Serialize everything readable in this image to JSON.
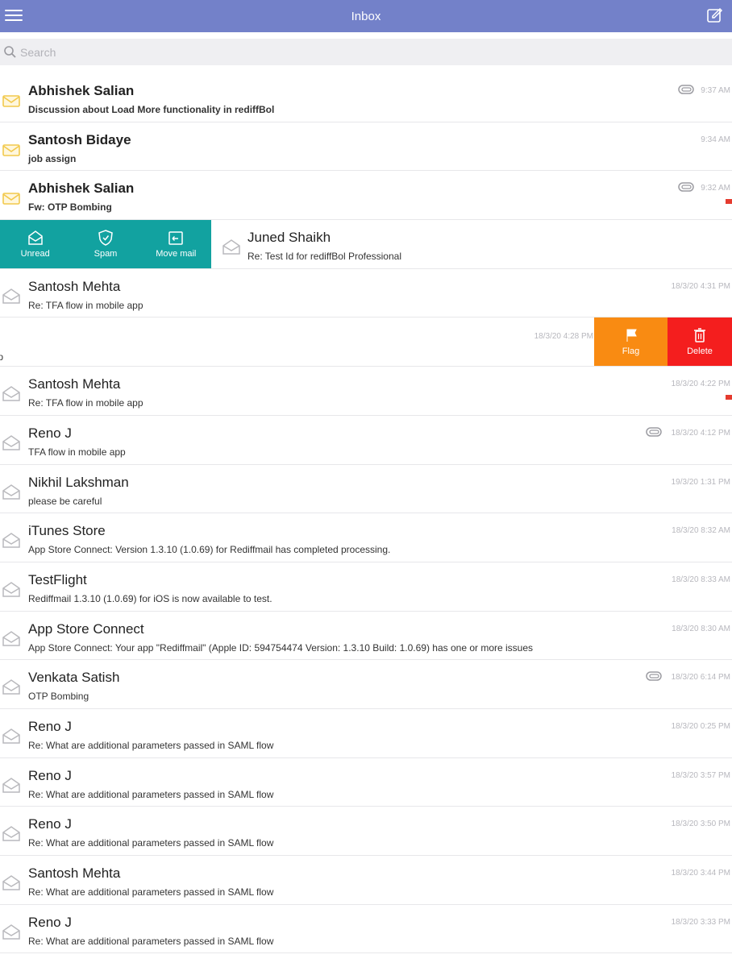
{
  "navbar": {
    "title": "Inbox",
    "menu_icon": "hamburger-menu-icon",
    "compose_icon": "compose-icon"
  },
  "search": {
    "placeholder": "Search",
    "icon": "search-icon"
  },
  "swipe_right_actions": [
    {
      "label": "Unread",
      "icon": "envelope-open-icon"
    },
    {
      "label": "Spam",
      "icon": "shield-icon"
    },
    {
      "label": "Move mail",
      "icon": "folder-move-icon"
    }
  ],
  "swipe_left_actions": [
    {
      "label": "Flag",
      "icon": "flag-icon",
      "color": "#f98b12"
    },
    {
      "label": "Delete",
      "icon": "trash-icon",
      "color": "#f41e1e"
    }
  ],
  "emails": [
    {
      "sender": "Abhishek Salian",
      "subject": "Discussion about Load More functionality in rediffBol",
      "time": "9:37 AM",
      "unread": true,
      "attachment": true,
      "flagged": false
    },
    {
      "sender": "Santosh Bidaye",
      "subject": "job assign",
      "time": "9:34 AM",
      "unread": true,
      "attachment": false,
      "flagged": false
    },
    {
      "sender": "Abhishek Salian",
      "subject": "Fw: OTP Bombing",
      "time": "9:32 AM",
      "unread": true,
      "attachment": true,
      "flagged": true
    },
    {
      "sender": "Juned Shaikh",
      "subject": "Re: Test Id for rediffBol Professional",
      "time": "",
      "unread": false,
      "attachment": false,
      "flagged": false,
      "swipe": "right"
    },
    {
      "sender": "Santosh Mehta",
      "subject": "Re: TFA flow in mobile app",
      "time": "18/3/20 4:31 PM",
      "unread": false,
      "attachment": false,
      "flagged": false
    },
    {
      "sender": "",
      "subject": "app",
      "time": "18/3/20 4:28 PM",
      "unread": false,
      "attachment": false,
      "flagged": false,
      "swipe": "left"
    },
    {
      "sender": "Santosh Mehta",
      "subject": "Re: TFA flow in mobile app",
      "time": "18/3/20 4:22 PM",
      "unread": false,
      "attachment": false,
      "flagged": true
    },
    {
      "sender": "Reno J",
      "subject": "TFA flow in mobile app",
      "time": "18/3/20 4:12 PM",
      "unread": false,
      "attachment": true,
      "flagged": false
    },
    {
      "sender": "Nikhil Lakshman",
      "subject": "please be careful",
      "time": "19/3/20 1:31 PM",
      "unread": false,
      "attachment": false,
      "flagged": false
    },
    {
      "sender": "iTunes Store",
      "subject": "App Store Connect: Version 1.3.10 (1.0.69) for Rediffmail has completed processing.",
      "time": "18/3/20 8:32 AM",
      "unread": false,
      "attachment": false,
      "flagged": false
    },
    {
      "sender": "TestFlight",
      "subject": "Rediffmail 1.3.10 (1.0.69) for iOS is now available to test.",
      "time": "18/3/20 8:33 AM",
      "unread": false,
      "attachment": false,
      "flagged": false
    },
    {
      "sender": "App Store Connect",
      "subject": "App Store Connect: Your app \"Rediffmail\" (Apple ID: 594754474 Version: 1.3.10 Build: 1.0.69) has one or more issues",
      "time": "18/3/20 8:30 AM",
      "unread": false,
      "attachment": false,
      "flagged": false
    },
    {
      "sender": "Venkata Satish",
      "subject": "OTP Bombing",
      "time": "18/3/20 6:14 PM",
      "unread": false,
      "attachment": true,
      "flagged": false
    },
    {
      "sender": "Reno J",
      "subject": "Re: What are additional parameters passed in SAML flow",
      "time": "18/3/20 0:25 PM",
      "unread": false,
      "attachment": false,
      "flagged": false
    },
    {
      "sender": "Reno J",
      "subject": "Re: What are additional parameters passed in SAML flow",
      "time": "18/3/20 3:57 PM",
      "unread": false,
      "attachment": false,
      "flagged": false
    },
    {
      "sender": "Reno J",
      "subject": "Re: What are additional parameters passed in SAML flow",
      "time": "18/3/20 3:50 PM",
      "unread": false,
      "attachment": false,
      "flagged": false
    },
    {
      "sender": "Santosh Mehta",
      "subject": "Re: What are additional parameters passed in SAML flow",
      "time": "18/3/20 3:44 PM",
      "unread": false,
      "attachment": false,
      "flagged": false
    },
    {
      "sender": "Reno J",
      "subject": "Re: What are additional parameters passed in SAML flow",
      "time": "18/3/20 3:33 PM",
      "unread": false,
      "attachment": false,
      "flagged": false
    }
  ],
  "colors": {
    "navbar": "#7381c9",
    "swipe_right_bg": "#12a2a0",
    "flag": "#f98b12",
    "delete": "#f41e1e",
    "unread_envelope": "#f2c94c",
    "read_envelope": "#b9b9bd"
  }
}
